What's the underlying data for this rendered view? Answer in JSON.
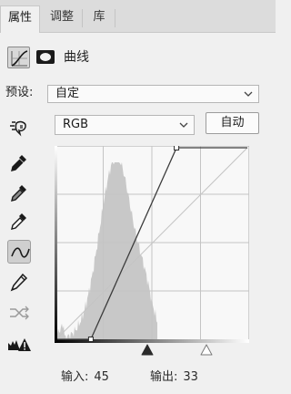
{
  "tabs": [
    {
      "label": "属性",
      "active": true
    },
    {
      "label": "调整",
      "active": false
    },
    {
      "label": "库",
      "active": false
    }
  ],
  "header": {
    "title": "曲线",
    "icons": [
      "curves-adjustment-icon",
      "layer-mask-icon"
    ]
  },
  "preset": {
    "label": "预设:",
    "value": "自定"
  },
  "channel": {
    "value": "RGB"
  },
  "auto_button": {
    "label": "自动"
  },
  "tools": [
    "on-image-adjust-icon",
    "black-point-eyedropper-icon",
    "gray-point-eyedropper-icon",
    "white-point-eyedropper-icon",
    "curve-point-tool-icon",
    "pencil-draw-icon",
    "smooth-curve-icon",
    "clipping-warning-icon"
  ],
  "curve": {
    "input_range": [
      0,
      255
    ],
    "output_range": [
      0,
      255
    ],
    "points": [
      [
        45,
        0
      ],
      [
        160,
        255
      ]
    ]
  },
  "readout": {
    "input_label": "输入:",
    "input_value": "45",
    "output_label": "输出:",
    "output_value": "33"
  },
  "colors": {
    "panel_bg": "#f0f0f0",
    "graph_bg": "#f8f8f8",
    "histogram": "#c8c8c8",
    "curve": "#3c3c3c"
  }
}
